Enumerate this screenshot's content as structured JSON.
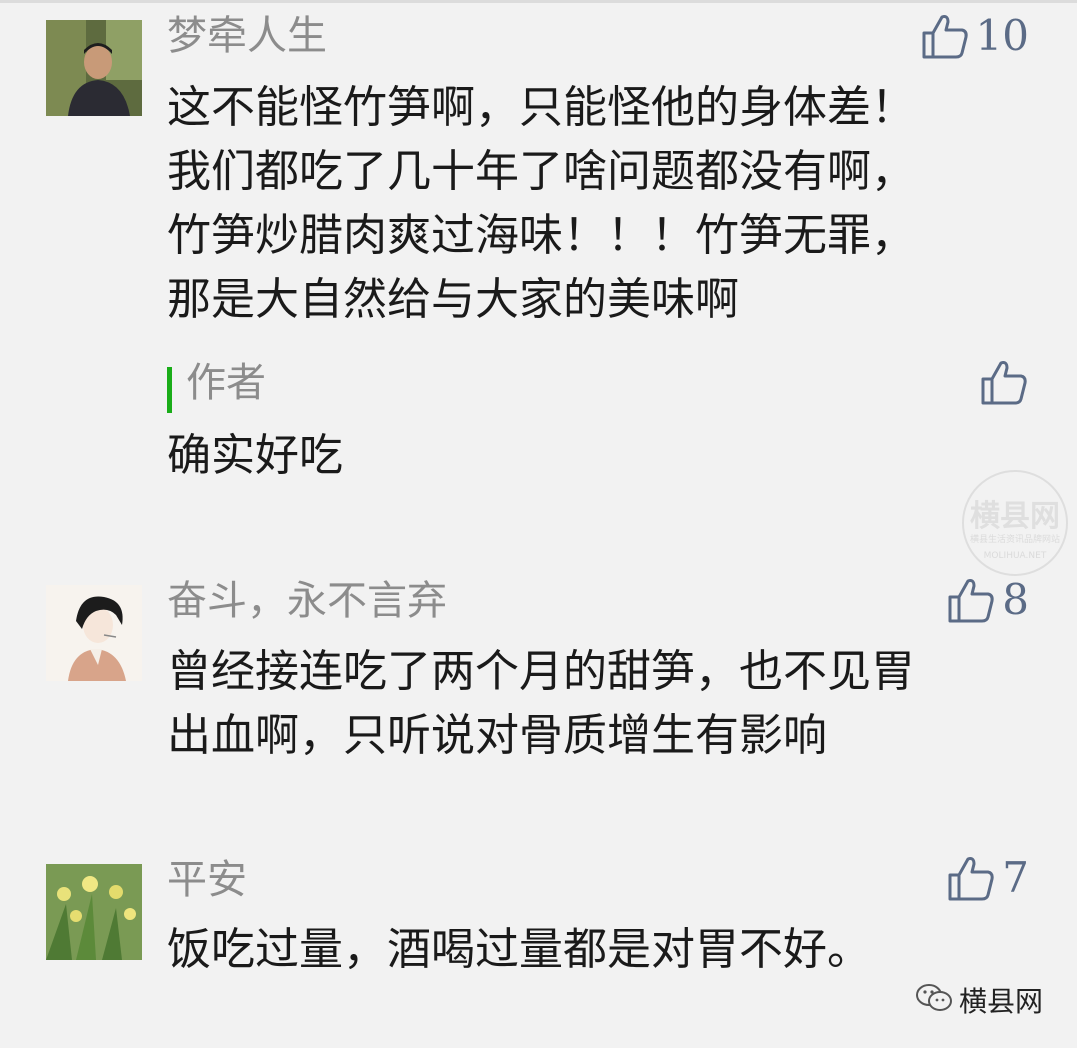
{
  "comments": [
    {
      "nickname": "梦牵人生",
      "likes": "10",
      "avatar": "avatar-photo-man",
      "lines": [
        "这不能怪竹笋啊，只能怪他的身体差！",
        "我们都吃了几十年了啥问题都没有啊，",
        "竹笋炒腊肉爽过海味！！！竹笋无罪，",
        "那是大自然给与大家的美味啊"
      ],
      "reply": {
        "author": "作者",
        "text": "确实好吃"
      }
    },
    {
      "nickname": "奋斗，永不言弃",
      "likes": "8",
      "avatar": "avatar-illustration-man",
      "lines": [
        "曾经接连吃了两个月的甜笋，也不见胃",
        "出血啊，只听说对骨质增生有影响"
      ]
    },
    {
      "nickname": "平安",
      "likes": "7",
      "avatar": "avatar-photo-flowers",
      "lines": [
        "饭吃过量，酒喝过量都是对胃不好。"
      ]
    }
  ],
  "watermark": {
    "text": "横县网",
    "subtext": "横县生活资讯品牌网站",
    "domain": "MOLIHUA.NET"
  },
  "brand": {
    "name": "横县网",
    "icon": "wechat-icon"
  },
  "colors": {
    "like_blue": "#5b6b86",
    "author_bar": "#1aad19",
    "nickname_gray": "#8c8c8c"
  }
}
